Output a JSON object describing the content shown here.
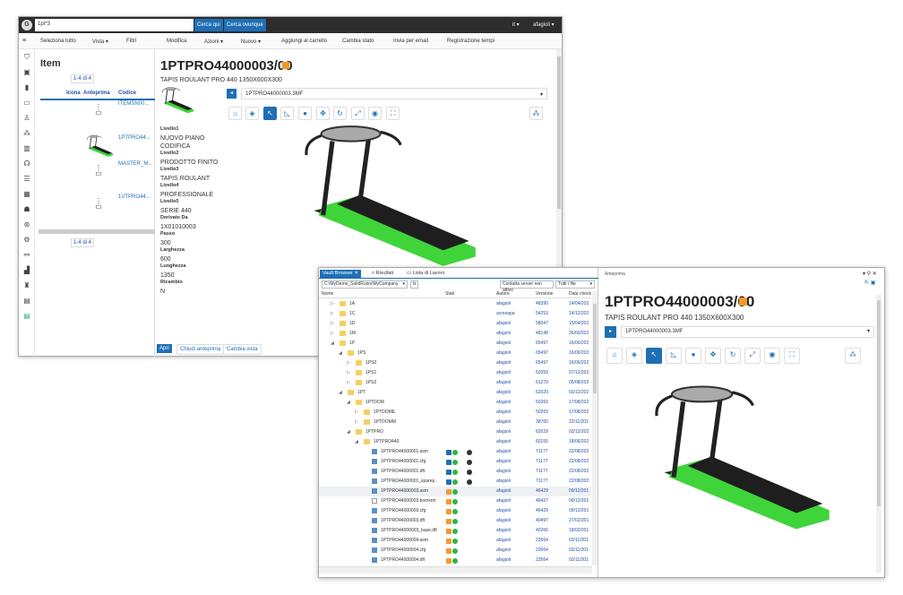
{
  "back": {
    "search_value": "1pt*3",
    "search_here": "Cerca qui",
    "search_everywhere": "Cerca ovunque",
    "lang": "it ▾",
    "user": "afagioli ▾",
    "toolbar": [
      "Seleziona tutto",
      "Vista ▾",
      "Filtri",
      "Modifica",
      "Azioni ▾",
      "Nuovo ▾",
      "Aggiungi al carrello",
      "Cambia stato",
      "Invia per email",
      "Registrazione tempi"
    ],
    "list": {
      "title": "Item",
      "pager": "1-4 di 4",
      "headers": [
        "Icona",
        "Anteprima",
        "Codice"
      ],
      "rows": [
        {
          "code": "ITEMSN00..."
        },
        {
          "code": "1PTPRO44..."
        },
        {
          "code": "MASTER_M..."
        },
        {
          "code": "1VTPRO44..."
        }
      ]
    },
    "detail": {
      "title": "1PTPRO44000003/00",
      "subtitle": "TAPIS ROULANT PRO 440 1350X600X300",
      "file": "1PTPRO44000003.3MF",
      "props": [
        {
          "label": "Livello1",
          "value": "NUOVO PIANO CODIFICA"
        },
        {
          "label": "Livello2",
          "value": "PRODOTTO FINITO"
        },
        {
          "label": "Livello3",
          "value": "TAPIS ROULANT"
        },
        {
          "label": "Livello4",
          "value": "PROFESSIONALE"
        },
        {
          "label": "Livello5",
          "value": "SERIE 440"
        },
        {
          "label": "Derivato Da",
          "value": "1X01010003"
        },
        {
          "label": "Passo",
          "value": "300"
        },
        {
          "label": "Larghezza",
          "value": "600"
        },
        {
          "label": "Lunghezza",
          "value": "1350"
        },
        {
          "label": "Ricambio",
          "value": "N"
        }
      ],
      "buttons": [
        "Apri",
        "Chiudi anteprima",
        "Cambia vista"
      ]
    }
  },
  "front": {
    "tabs": [
      "Vault Browser",
      "Risultati",
      "Lista di Lavoro"
    ],
    "path": "C:\\MyDemo_SolidRules\\MyCompany",
    "server": "Contatta server non attivo",
    "filter": "Tutti i file",
    "headers": [
      "Nome",
      "Stati",
      "Autore",
      "Versione",
      "Data check"
    ],
    "rows": [
      {
        "n": "1A",
        "l": 1,
        "t": "folder",
        "e": "closed",
        "a": "afagioli",
        "v": "48390",
        "d": "14/04/202"
      },
      {
        "n": "1C",
        "l": 1,
        "t": "folder",
        "e": "closed",
        "a": "acmeapa",
        "v": "54253",
        "d": "14/12/202"
      },
      {
        "n": "1D",
        "l": 1,
        "t": "folder",
        "e": "closed",
        "a": "afagioli",
        "v": "58047",
        "d": "15/04/202"
      },
      {
        "n": "1M",
        "l": 1,
        "t": "folder",
        "e": "closed",
        "a": "afagioli",
        "v": "48148",
        "d": "26/03/202"
      },
      {
        "n": "1P",
        "l": 1,
        "t": "folder",
        "e": "open",
        "a": "afagioli",
        "v": "65497",
        "d": "16/06/202"
      },
      {
        "n": "1PS",
        "l": 2,
        "t": "folder",
        "e": "open",
        "a": "afagioli",
        "v": "65497",
        "d": "16/06/202"
      },
      {
        "n": "1PS0",
        "l": 3,
        "t": "folder",
        "e": "closed",
        "a": "afagioli",
        "v": "65497",
        "d": "16/06/202"
      },
      {
        "n": "1PS1",
        "l": 3,
        "t": "folder",
        "e": "closed",
        "a": "afagioli",
        "v": "62059",
        "d": "07/12/202"
      },
      {
        "n": "1PS2",
        "l": 3,
        "t": "folder",
        "e": "closed",
        "a": "afagioli",
        "v": "61279",
        "d": "05/08/202"
      },
      {
        "n": "1PT",
        "l": 2,
        "t": "folder",
        "e": "open",
        "a": "afagioli",
        "v": "62029",
        "d": "03/12/202"
      },
      {
        "n": "1PTDOM",
        "l": 3,
        "t": "folder",
        "e": "open",
        "a": "afagioli",
        "v": "50269",
        "d": "17/08/202"
      },
      {
        "n": "1PTDOME",
        "l": 4,
        "t": "folder",
        "e": "closed",
        "a": "afagioli",
        "v": "50269",
        "d": "17/08/202"
      },
      {
        "n": "1PTDOMM",
        "l": 4,
        "t": "folder",
        "e": "closed",
        "a": "afagioli",
        "v": "38760",
        "d": "22/11/201"
      },
      {
        "n": "1PTPRO",
        "l": 3,
        "t": "folder",
        "e": "open",
        "a": "afagioli",
        "v": "62029",
        "d": "03/12/202"
      },
      {
        "n": "1PTPRO440",
        "l": 4,
        "t": "folder",
        "e": "open",
        "a": "afagioli",
        "v": "60155",
        "d": "18/06/202"
      },
      {
        "n": "1PTPRO44000001.asm",
        "l": 5,
        "t": "file",
        "s": "released",
        "a": "afagioli",
        "v": "71177",
        "d": "22/08/202"
      },
      {
        "n": "1PTPRO44000001.cfg",
        "l": 5,
        "t": "file",
        "s": "released",
        "a": "afagioli",
        "v": "71177",
        "d": "22/08/202"
      },
      {
        "n": "1PTPRO44000001.dft",
        "l": 5,
        "t": "file",
        "s": "released",
        "a": "afagioli",
        "v": "71177",
        "d": "22/08/202"
      },
      {
        "n": "1PTPRO44000001_sparep..",
        "l": 5,
        "t": "file",
        "s": "released",
        "a": "afagioli",
        "v": "71177",
        "d": "22/08/202"
      },
      {
        "n": "1PTPRO44000003.asm",
        "l": 5,
        "t": "file",
        "s": "wip",
        "a": "afagioli",
        "v": "46429",
        "d": "09/12/201",
        "sel": true
      },
      {
        "n": "1PTPRO44000003.bomxml",
        "l": 5,
        "t": "doc",
        "s": "wip",
        "a": "afagioli",
        "v": "46427",
        "d": "09/12/201"
      },
      {
        "n": "1PTPRO44000003.cfg",
        "l": 5,
        "t": "file",
        "s": "wip",
        "a": "afagioli",
        "v": "46429",
        "d": "09/12/201"
      },
      {
        "n": "1PTPRO44000003.dft",
        "l": 5,
        "t": "file",
        "s": "wip",
        "a": "afagioli",
        "v": "40497",
        "d": "27/02/201"
      },
      {
        "n": "1PTPRO44000003_base.dft",
        "l": 5,
        "t": "file",
        "s": "wip",
        "a": "afagioli",
        "v": "40266",
        "d": "18/02/201"
      },
      {
        "n": "1PTPRO44000004.asm",
        "l": 5,
        "t": "file",
        "s": "wip",
        "a": "afagioli",
        "v": "23564",
        "d": "03/11/201"
      },
      {
        "n": "1PTPRO44000004.cfg",
        "l": 5,
        "t": "file",
        "s": "wip",
        "a": "afagioli",
        "v": "23564",
        "d": "03/11/201"
      },
      {
        "n": "1PTPRO44000004.dft",
        "l": 5,
        "t": "file",
        "s": "wip",
        "a": "afagioli",
        "v": "23564",
        "d": "03/11/201"
      }
    ],
    "preview": {
      "panel_title": "Anteprima",
      "title": "1PTPRO44000003/00",
      "subtitle": "TAPIS ROULANT PRO 440 1350X600X300",
      "file": "1PTPRO44000003.3MF"
    }
  },
  "colors": {
    "accent": "#1f6fb5",
    "treadmill_green": "#3fd43a",
    "wip": "#f39a2b",
    "ok": "#2fb34a"
  }
}
